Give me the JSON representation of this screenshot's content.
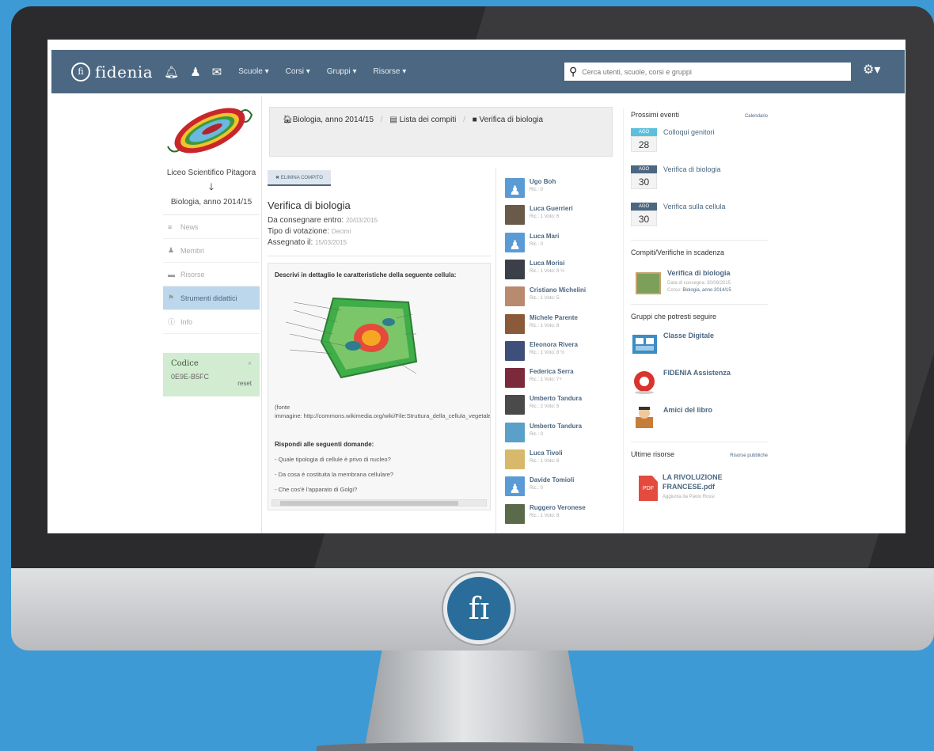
{
  "app": {
    "logo_glyph": "fi",
    "logo_text": "fidenia"
  },
  "navbar": {
    "menus": [
      "Scuole ▾",
      "Corsi ▾",
      "Gruppi ▾",
      "Risorse ▾"
    ],
    "search_placeholder": "Cerca utenti, scuole, corsi e gruppi",
    "icons": [
      "bell-icon",
      "user-icon",
      "envelope-icon",
      "gear-icon"
    ],
    "bg_color": "#4c6781"
  },
  "sidebar": {
    "school": "Liceo Scientifico Pitagora",
    "course": "Biologia, anno 2014/15",
    "items": [
      {
        "label": "News",
        "icon": "≡"
      },
      {
        "label": "Membri",
        "icon": "♟"
      },
      {
        "label": "Risorse",
        "icon": "▬"
      },
      {
        "label": "Strumenti didattici",
        "icon": "⚑"
      },
      {
        "label": "Info",
        "icon": "ⓘ"
      }
    ],
    "codice_title": "Codice",
    "codice_value": "0E9E-B5FC",
    "codice_close": "×",
    "codice_reset": "reset"
  },
  "breadcrumb": {
    "items": [
      "Biologia, anno 2014/15",
      "Lista dei compiti",
      "Verifica di biologia"
    ],
    "separator": "/"
  },
  "task": {
    "delete_label": "✖ ELIMINA COMPITO",
    "title": "Verifica di biologia",
    "due_label": "Da consegnare entro:",
    "due_value": "20/03/2015",
    "vote_label": "Tipo di votazione:",
    "vote_value": "Decimi",
    "assigned_label": "Assegnato il:",
    "assigned_value": "15/03/2015",
    "description": "Descrivi in dettaglio le caratteristiche della seguente cellula:",
    "fonte": "(fonte",
    "image_source": "immagine: http://commons.wikimedia.org/wiki/File:Struttura_della_cellula_vegetale.svg)",
    "questions_title": "Rispondi alle seguenti domande:",
    "questions": [
      "- Quale tipologia di cellule è privo di nucleo?",
      "- Da cosa è costituita la membrana cellulare?",
      "- Che cos'è l'apparato di Golgi?"
    ]
  },
  "students": [
    {
      "name": "Ugo Boh",
      "meta": "Ric.: 0",
      "avatar": "blank"
    },
    {
      "name": "Luca Guerrieri",
      "meta": "Ric.: 1 Voto: 6",
      "avatar": "photo",
      "color": "#6a5a4a"
    },
    {
      "name": "Luca Mari",
      "meta": "Ric.: 0",
      "avatar": "blank"
    },
    {
      "name": "Luca Morisi",
      "meta": "Ric.: 1 Voto: 8 ½",
      "avatar": "photo",
      "color": "#3a3f48"
    },
    {
      "name": "Cristiano Michelini",
      "meta": "Ric.: 1 Voto: 5-",
      "avatar": "photo",
      "color": "#b88a70"
    },
    {
      "name": "Michele Parente",
      "meta": "Ric.: 1 Voto: 8",
      "avatar": "photo",
      "color": "#8a5a3a"
    },
    {
      "name": "Eleonora Rivera",
      "meta": "Ric.: 1 Voto: 8 ½",
      "avatar": "photo",
      "color": "#3d4f7a"
    },
    {
      "name": "Federica Serra",
      "meta": "Ric.: 1 Voto: 7+",
      "avatar": "photo",
      "color": "#7a2a3a"
    },
    {
      "name": "Umberto Tandura",
      "meta": "Ric.: 2 Voto: 5",
      "avatar": "photo",
      "color": "#4a4a4a"
    },
    {
      "name": "Umberto Tandura",
      "meta": "Ric.: 0",
      "avatar": "photo",
      "color": "#5aa0c8"
    },
    {
      "name": "Luca Tivoli",
      "meta": "Ric.: 1 Voto: 6",
      "avatar": "photo",
      "color": "#d8b86a"
    },
    {
      "name": "Davide Tomioli",
      "meta": "Ric.: 0",
      "avatar": "blank"
    },
    {
      "name": "Ruggero Veronese",
      "meta": "Ric.: 1 Voto: 8",
      "avatar": "photo",
      "color": "#5a6a4a"
    }
  ],
  "right": {
    "events_title": "Prossimi eventi",
    "calendar_link": "Calendario",
    "events": [
      {
        "month": "AGO",
        "day": "28",
        "title": "Colloqui genitori",
        "color": "#5bc0de"
      },
      {
        "month": "AGO",
        "day": "30",
        "title": "Verifica di biologia",
        "color": "#4c6781"
      },
      {
        "month": "AGO",
        "day": "30",
        "title": "Verifica sulla cellula",
        "color": "#4c6781"
      }
    ],
    "due_title": "Compiti/Verifiche in scadenza",
    "due_item_title": "Verifica di biologia",
    "due_item_date": "Data di consegna: 30/08/2015",
    "due_item_course_label": "Corso:",
    "due_item_course": "Biologia, anno 2014/15",
    "groups_title": "Gruppi che potresti seguire",
    "groups": [
      "Classe Digitale",
      "FIDENIA Assistenza",
      "Amici del libro"
    ],
    "resources_title": "Ultime risorse",
    "resources_link": "Risorse pubbliche",
    "resource_icon": "PDF",
    "resource_title": "LA RIVOLUZIONE FRANCESE.pdf",
    "resource_meta": "Aggiunta da Paolo Rossi"
  },
  "monitor": {
    "chin_logo": "fɪ"
  }
}
